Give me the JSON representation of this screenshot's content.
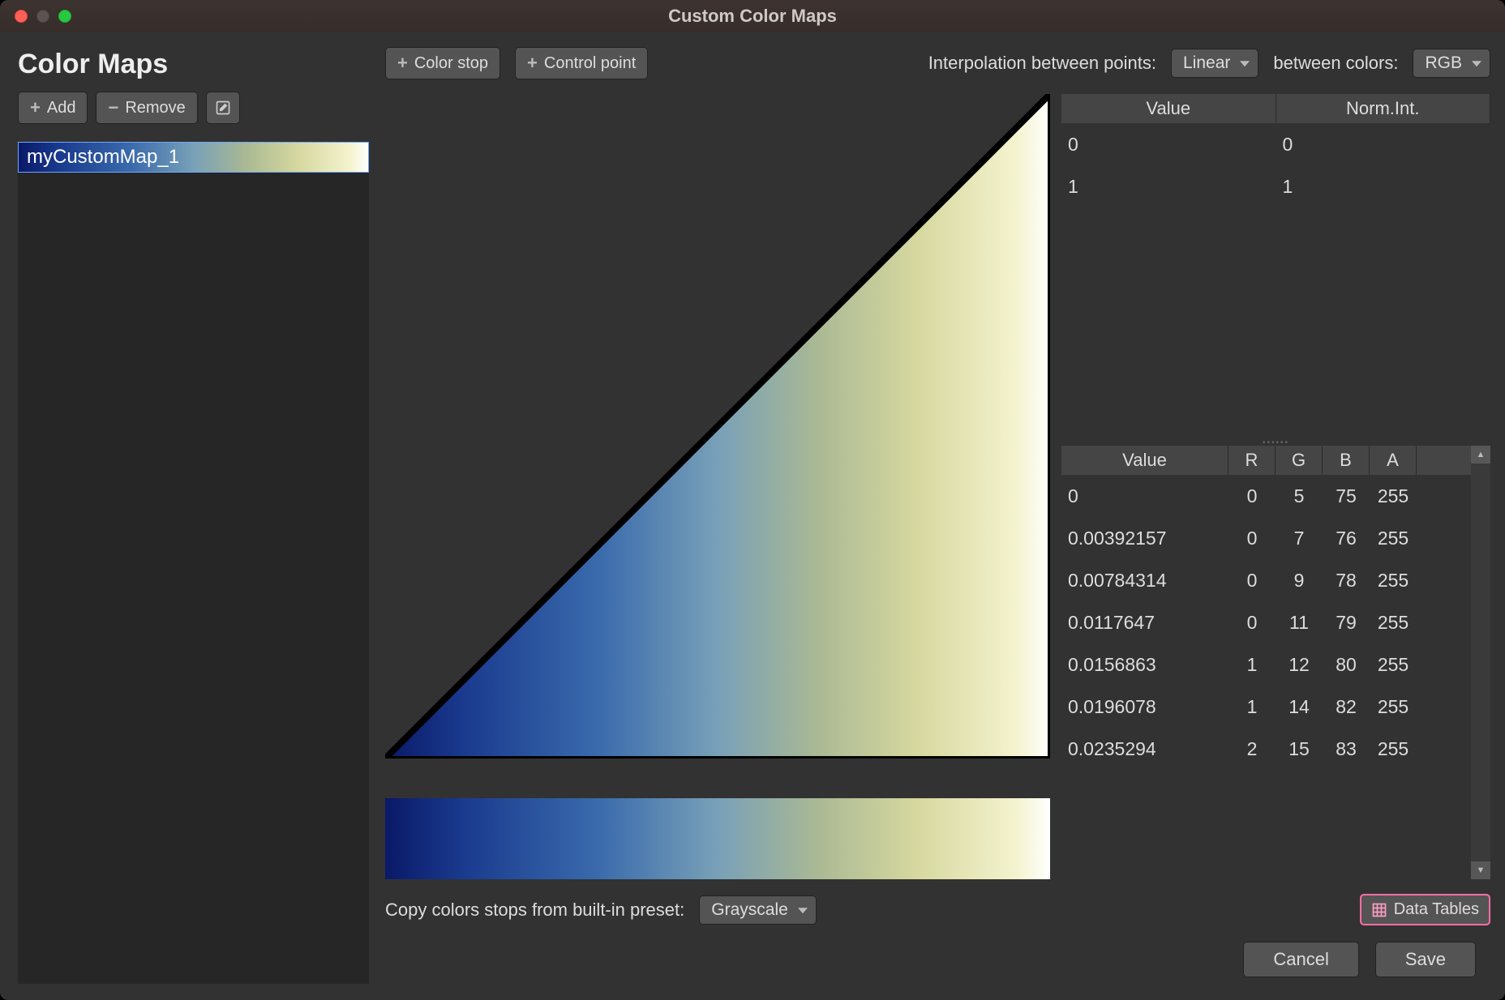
{
  "window": {
    "title": "Custom Color Maps"
  },
  "sidebar": {
    "heading": "Color Maps",
    "add_label": "Add",
    "remove_label": "Remove",
    "items": [
      {
        "name": "myCustomMap_1"
      }
    ]
  },
  "toolbar": {
    "color_stop_label": "Color stop",
    "control_point_label": "Control point",
    "interp_label": "Interpolation between points:",
    "interp_value": "Linear",
    "between_colors_label": "between colors:",
    "between_colors_value": "RGB"
  },
  "norm_table": {
    "col_value": "Value",
    "col_norm": "Norm.Int.",
    "rows": [
      {
        "value": "0",
        "norm": "0"
      },
      {
        "value": "1",
        "norm": "1"
      }
    ]
  },
  "rgba_table": {
    "col_value": "Value",
    "col_r": "R",
    "col_g": "G",
    "col_b": "B",
    "col_a": "A",
    "rows": [
      {
        "value": "0",
        "r": "0",
        "g": "5",
        "b": "75",
        "a": "255"
      },
      {
        "value": "0.00392157",
        "r": "0",
        "g": "7",
        "b": "76",
        "a": "255"
      },
      {
        "value": "0.00784314",
        "r": "0",
        "g": "9",
        "b": "78",
        "a": "255"
      },
      {
        "value": "0.0117647",
        "r": "0",
        "g": "11",
        "b": "79",
        "a": "255"
      },
      {
        "value": "0.0156863",
        "r": "1",
        "g": "12",
        "b": "80",
        "a": "255"
      },
      {
        "value": "0.0196078",
        "r": "1",
        "g": "14",
        "b": "82",
        "a": "255"
      },
      {
        "value": "0.0235294",
        "r": "2",
        "g": "15",
        "b": "83",
        "a": "255"
      }
    ]
  },
  "copy_preset": {
    "label": "Copy colors stops from built-in preset:",
    "value": "Grayscale"
  },
  "data_tables_label": "Data Tables",
  "footer": {
    "cancel": "Cancel",
    "save": "Save"
  }
}
